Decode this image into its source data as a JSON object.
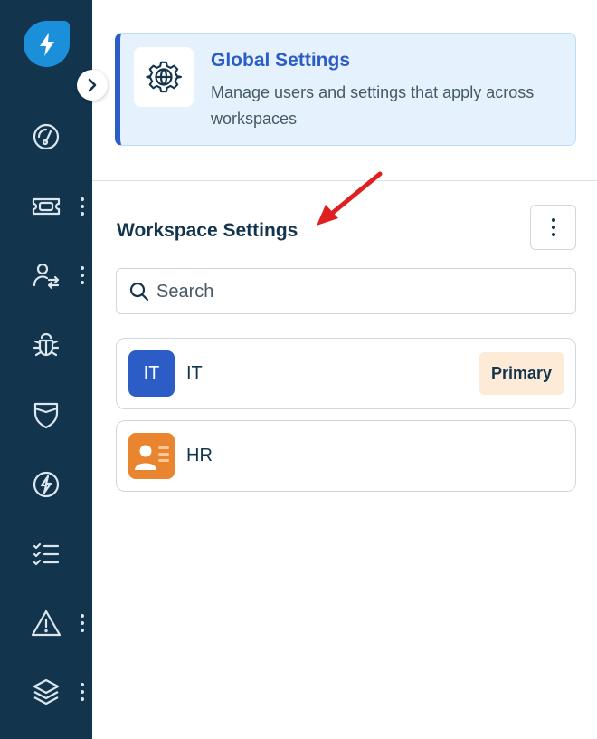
{
  "sidebar": {
    "logo_icon": "bolt-logo-icon",
    "expand_icon": "chevron-right-icon",
    "items": [
      {
        "icon": "dashboard-gauge-icon",
        "has_menu": false
      },
      {
        "icon": "ticket-icon",
        "has_menu": true
      },
      {
        "icon": "user-swap-icon",
        "has_menu": true
      },
      {
        "icon": "bug-icon",
        "has_menu": false
      },
      {
        "icon": "shield-icon",
        "has_menu": false
      },
      {
        "icon": "bolt-circle-icon",
        "has_menu": false
      },
      {
        "icon": "checklist-icon",
        "has_menu": false
      },
      {
        "icon": "warning-icon",
        "has_menu": true
      },
      {
        "icon": "layers-icon",
        "has_menu": true
      }
    ]
  },
  "global_settings": {
    "title": "Global Settings",
    "description": "Manage users and settings that apply across workspaces",
    "icon": "globe-gear-icon"
  },
  "workspace_settings": {
    "title": "Workspace Settings",
    "menu_icon": "kebab-menu-icon"
  },
  "search": {
    "placeholder": "Search",
    "value": ""
  },
  "workspaces": [
    {
      "name": "IT",
      "avatar_text": "IT",
      "avatar_color": "#2c5cc5",
      "badge": "Primary"
    },
    {
      "name": "HR",
      "avatar_text": "",
      "avatar_color": "#e9852f",
      "badge": ""
    }
  ],
  "colors": {
    "sidebar_bg": "#12344d",
    "accent": "#2c5cc5",
    "annotation_arrow": "#e02020"
  }
}
